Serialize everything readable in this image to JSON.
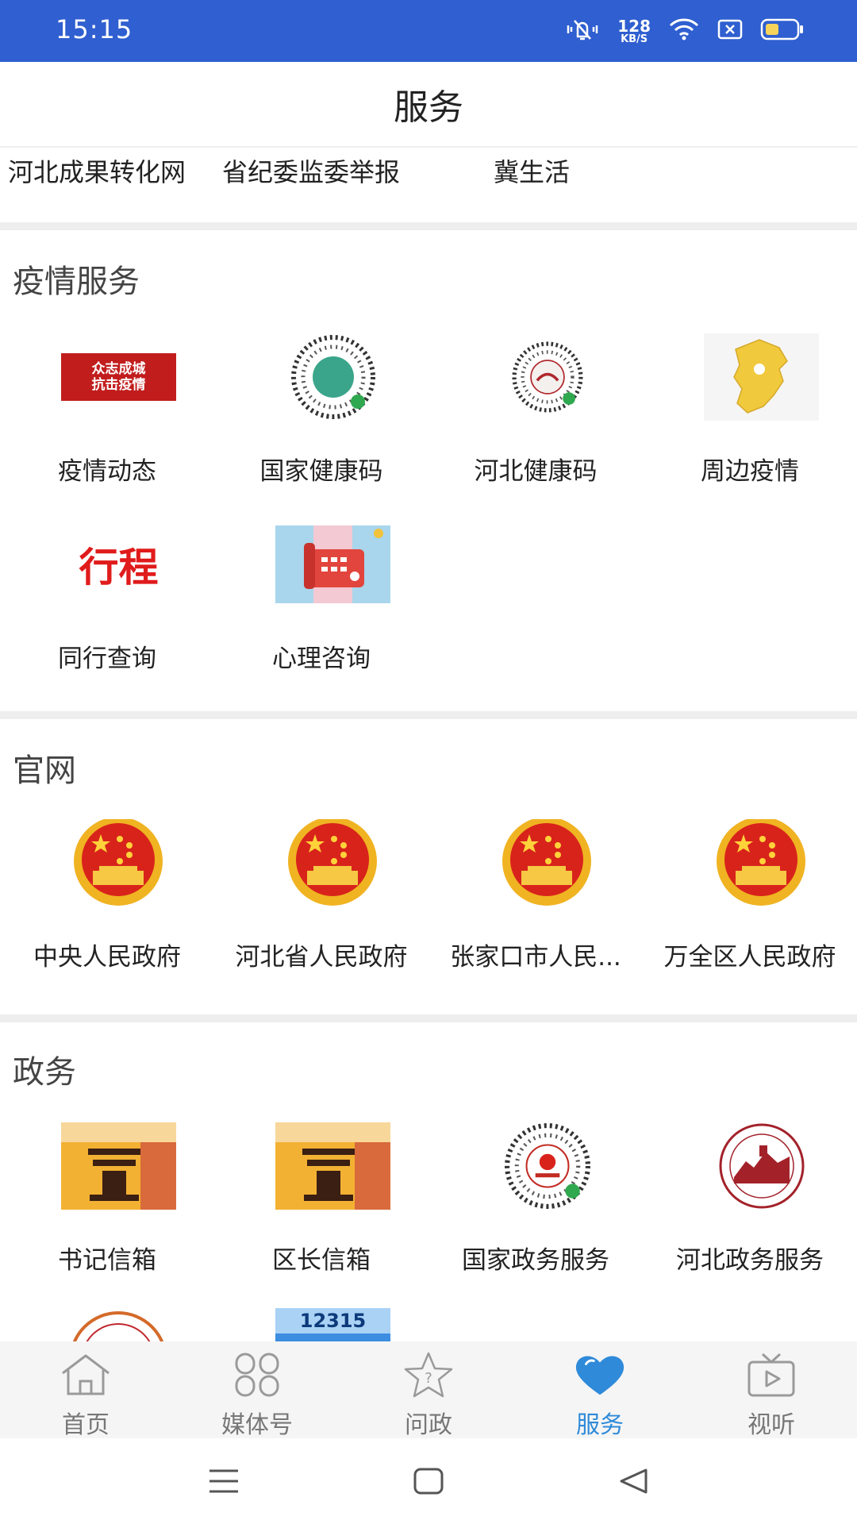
{
  "status_bar": {
    "time": "15:15",
    "net_speed_value": "128",
    "net_speed_unit": "KB/S"
  },
  "header": {
    "title": "服务"
  },
  "quick_links": [
    "河北成果转化网",
    "省纪委监委举报",
    "冀生活"
  ],
  "sections": {
    "epidemic": {
      "title": "疫情服务",
      "items": [
        {
          "label": "疫情动态",
          "thumb_text_1": "众志成城",
          "thumb_text_2": "抗击疫情"
        },
        {
          "label": "国家健康码"
        },
        {
          "label": "河北健康码"
        },
        {
          "label": "周边疫情"
        },
        {
          "label": "同行查询",
          "thumb_text": "行程"
        },
        {
          "label": "心理咨询"
        }
      ]
    },
    "official_sites": {
      "title": "官网",
      "items": [
        {
          "label": "中央人民政府"
        },
        {
          "label": "河北省人民政府"
        },
        {
          "label": "张家口市人民..."
        },
        {
          "label": "万全区人民政府"
        }
      ]
    },
    "government_affairs": {
      "title": "政务",
      "items": [
        {
          "label": "书记信箱"
        },
        {
          "label": "区长信箱"
        },
        {
          "label": "国家政务服务"
        },
        {
          "label": "河北政务服务"
        },
        {
          "label": ""
        },
        {
          "label": "",
          "thumb_text": "12315"
        }
      ]
    }
  },
  "bottom_nav": [
    {
      "label": "首页",
      "icon": "home-icon"
    },
    {
      "label": "媒体号",
      "icon": "media-grid-icon"
    },
    {
      "label": "问政",
      "icon": "question-star-icon"
    },
    {
      "label": "服务",
      "icon": "heart-icon",
      "active": true
    },
    {
      "label": "视听",
      "icon": "tv-play-icon"
    }
  ],
  "colors": {
    "status_bar": "#2f5fd0",
    "active_tab": "#2f8ad9",
    "divider": "#eeeeee"
  }
}
